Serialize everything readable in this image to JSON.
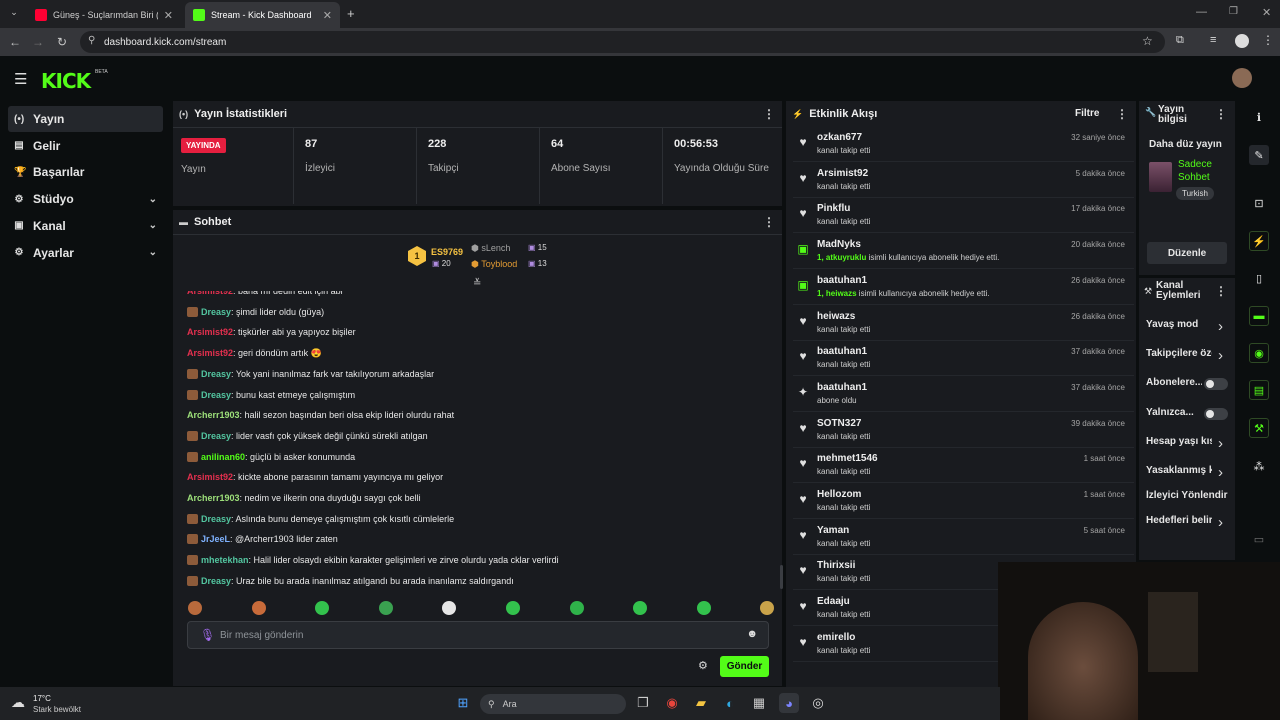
{
  "browser": {
    "tabs": [
      {
        "label": "Güneş - Suçlarımdan Biri (Offic",
        "favicon_color": "#ff0033"
      },
      {
        "label": "Stream - Kick Dashboard",
        "favicon_color": "#53fc18"
      }
    ],
    "url": "dashboard.kick.com/stream"
  },
  "app": {
    "logo": "KICK",
    "beta": "BETA"
  },
  "sidebar": {
    "items": [
      {
        "icon": "broadcast-icon",
        "glyph": "(•)",
        "label": "Yayın",
        "active": true
      },
      {
        "icon": "wallet-icon",
        "glyph": "▤",
        "label": "Gelir"
      },
      {
        "icon": "trophy-icon",
        "glyph": "🏆",
        "label": "Başarılar"
      },
      {
        "icon": "studio-icon",
        "glyph": "⚙",
        "label": "Stüdyo",
        "expandable": true
      },
      {
        "icon": "channel-icon",
        "glyph": "▣",
        "label": "Kanal",
        "expandable": true
      },
      {
        "icon": "settings-icon",
        "glyph": "⚙",
        "label": "Ayarlar",
        "expandable": true
      }
    ]
  },
  "stats_panel": {
    "title": "Yayın İstatistikleri",
    "live_badge": "YAYINDA",
    "live_label": "Yayın",
    "stats": [
      {
        "value": "87",
        "label": "İzleyici"
      },
      {
        "value": "228",
        "label": "Takipçi"
      },
      {
        "value": "64",
        "label": "Abone Sayısı"
      },
      {
        "value": "00:56:53",
        "label": "Yayında Olduğu Süre"
      }
    ]
  },
  "chat": {
    "title": "Sohbet",
    "leaderboard": [
      {
        "name": "ES9769",
        "count": "20",
        "color": "#f5c242"
      },
      {
        "name": "sLench",
        "count": "15",
        "color": "#a0a0a0"
      },
      {
        "name": "Toyblood",
        "count": "13",
        "color": "#e39b33"
      }
    ],
    "messages": [
      {
        "user": "Arsimist92",
        "text": ": bana mı dedin edit için abi",
        "color": "#e5304f",
        "badge": false
      },
      {
        "user": "Dreasy",
        "text": ": şimdi lider oldu (güya)",
        "color": "#53c6a0",
        "badge": true
      },
      {
        "user": "Arsimist92",
        "text": ": tişkürler abi ya yapıyoz bişiler",
        "color": "#e5304f",
        "badge": false
      },
      {
        "user": "Arsimist92",
        "text": ": geri döndüm artık 😍",
        "color": "#e5304f",
        "badge": false
      },
      {
        "user": "Dreasy",
        "text": ": Yok yani inanılmaz fark var takılıyorum arkadaşlar",
        "color": "#53c6a0",
        "badge": true
      },
      {
        "user": "Dreasy",
        "text": ": bunu kast etmeye çalışmıştım",
        "color": "#53c6a0",
        "badge": true
      },
      {
        "user": "Archerr1903",
        "text": ": halil sezon başından beri olsa ekip lideri olurdu rahat",
        "color": "#9de07a",
        "badge": false
      },
      {
        "user": "Dreasy",
        "text": ": lider vasfı çok yüksek değil çünkü sürekli atılgan",
        "color": "#53c6a0",
        "badge": true
      },
      {
        "user": "anilinan60",
        "text": ": güçlü bi asker konumunda",
        "color": "#53fc18",
        "badge": true
      },
      {
        "user": "Arsimist92",
        "text": ": kickte abone parasının tamamı yayıncıya mı geliyor",
        "color": "#e5304f",
        "badge": false
      },
      {
        "user": "Archerr1903",
        "text": ": nedim ve ilkerin ona duyduğu saygı çok belli",
        "color": "#9de07a",
        "badge": false
      },
      {
        "user": "Dreasy",
        "text": ": Aslında bunu demeye çalışmıştım çok kısıtlı cümlelerle",
        "color": "#53c6a0",
        "badge": true
      },
      {
        "user": "JrJeeL",
        "text": ": @Archerr1903 lider zaten",
        "color": "#7fb2ff",
        "badge": true
      },
      {
        "user": "mhetekhan",
        "text": ": Halil lider olsaydı ekibin karakter gelişimleri ve zirve olurdu yada cklar verlirdi",
        "color": "#53c6a0",
        "badge": true
      },
      {
        "user": "Dreasy",
        "text": ": Uraz bile bu arada inanılmaz atılgandı bu arada inanılamz saldırgandı",
        "color": "#53c6a0",
        "badge": true
      }
    ],
    "emotes": [
      "#b86a3c",
      "#c86b3a",
      "#33c24d",
      "#3aa150",
      "#e6e6e6",
      "#33c24d",
      "#2fb34a",
      "#33c24d",
      "#33c24d",
      "#c9a34a"
    ],
    "input_placeholder": "Bir mesaj gönderin",
    "send_label": "Gönder"
  },
  "events": {
    "title": "Etkinlik Akışı",
    "filter_label": "Filtre",
    "items": [
      {
        "name": "ozkan677",
        "action": "kanalı takip etti",
        "time": "32 saniye önce",
        "icon": "heart"
      },
      {
        "name": "Arsimist92",
        "action": "kanalı takip etti",
        "time": "5 dakika önce",
        "icon": "heart"
      },
      {
        "name": "Pinkflu",
        "action": "kanalı takip etti",
        "time": "17 dakika önce",
        "icon": "heart"
      },
      {
        "name": "MadNyks",
        "action_hl": "1, atkuyruklu",
        "action": " isimli kullanıcıya abonelik hediye etti.",
        "time": "20 dakika önce",
        "icon": "gift"
      },
      {
        "name": "baatuhan1",
        "action_hl": "1, heiwazs",
        "action": " isimli kullanıcıya abonelik hediye etti.",
        "time": "26 dakika önce",
        "icon": "gift"
      },
      {
        "name": "heiwazs",
        "action": "kanalı takip etti",
        "time": "26 dakika önce",
        "icon": "heart"
      },
      {
        "name": "baatuhan1",
        "action": "kanalı takip etti",
        "time": "37 dakika önce",
        "icon": "heart"
      },
      {
        "name": "baatuhan1",
        "action": "abone oldu",
        "time": "37 dakika önce",
        "icon": "star"
      },
      {
        "name": "SOTN327",
        "action": "kanalı takip etti",
        "time": "39 dakika önce",
        "icon": "heart"
      },
      {
        "name": "mehmet1546",
        "action": "kanalı takip etti",
        "time": "1 saat önce",
        "icon": "heart"
      },
      {
        "name": "Hellozom",
        "action": "kanalı takip etti",
        "time": "1 saat önce",
        "icon": "heart"
      },
      {
        "name": "Yaman",
        "action": "kanalı takip etti",
        "time": "5 saat önce",
        "icon": "heart"
      },
      {
        "name": "Thirixsii",
        "action": "kanalı takip etti",
        "time": "",
        "icon": "heart"
      },
      {
        "name": "Edaaju",
        "action": "kanalı takip etti",
        "time": "",
        "icon": "heart"
      },
      {
        "name": "emirello",
        "action": "kanalı takip etti",
        "time": "",
        "icon": "heart"
      }
    ]
  },
  "stream_info": {
    "title": "Yayın bilgisi",
    "stream_title": "Daha düz yayın",
    "category": "Sadece Sohbet",
    "language": "Turkish",
    "edit_label": "Düzenle"
  },
  "channel_actions": {
    "title": "Kanal Eylemleri",
    "items": [
      {
        "label": "Yavaş mod",
        "control": "chevron"
      },
      {
        "label": "Takipçilere özel",
        "control": "chevron"
      },
      {
        "label": "Abonelere...",
        "control": "toggle"
      },
      {
        "label": "Yalnızca...",
        "control": "toggle"
      },
      {
        "label": "Hesap yaşı kısıtlaması",
        "control": "chevron"
      },
      {
        "label": "Yasaklanmış kelimeler",
        "control": "chevron"
      },
      {
        "label": "İzleyici Yönlendir",
        "control": "none"
      },
      {
        "label": "Hedefleri belirle",
        "control": "chevron"
      }
    ]
  },
  "taskbar": {
    "weather_temp": "17°C",
    "weather_desc": "Stark bewölkt",
    "search_placeholder": "Ara"
  }
}
